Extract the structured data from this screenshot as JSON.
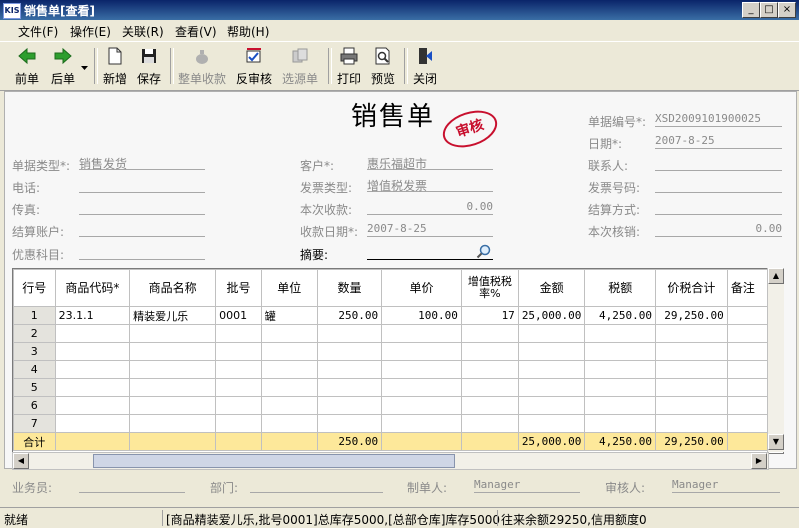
{
  "window": {
    "title": "销售单[查看]",
    "app_icon": "KIS",
    "minimize": "_",
    "restore": "□",
    "close": "×"
  },
  "menu": [
    "文件(F)",
    "操作(E)",
    "关联(R)",
    "查看(V)",
    "帮助(H)"
  ],
  "toolbar": {
    "prev": "前单",
    "next": "后单",
    "new": "新增",
    "save": "保存",
    "collect": "整单收款",
    "unapprove": "反审核",
    "select_source": "选源单",
    "print": "打印",
    "preview": "预览",
    "close": "关闭"
  },
  "icons": {
    "prev": "arrow-left-icon",
    "next": "arrow-right-icon",
    "new": "new-doc-icon",
    "save": "floppy-icon",
    "collect": "money-bag-icon",
    "unapprove": "unapprove-icon",
    "select_source": "select-source-icon",
    "print": "printer-icon",
    "preview": "preview-icon",
    "close": "exit-icon",
    "summary_lookup": "magnifier-icon"
  },
  "colors": {
    "title_bar": "#0a246a",
    "stamp": "#c8102e",
    "total_row": "#fde89a",
    "label_gray": "#8a8a8a"
  },
  "header": {
    "title": "销售单",
    "stamp": "审核",
    "doc_no_label": "单据编号*:",
    "doc_no": "XSD2009101900025",
    "date_label": "日期*:",
    "date": "2007-8-25",
    "doc_type_label": "单据类型*:",
    "doc_type": "销售发货",
    "customer_label": "客户*:",
    "customer": "惠乐福超市",
    "contact_label": "联系人:",
    "contact": "",
    "phone_label": "电话:",
    "phone": "",
    "invoice_type_label": "发票类型:",
    "invoice_type": "增值税发票",
    "invoice_no_label": "发票号码:",
    "invoice_no": "",
    "fax_label": "传真:",
    "fax": "",
    "this_receipt_label": "本次收款:",
    "this_receipt": "0.00",
    "settle_method_label": "结算方式:",
    "settle_method": "",
    "settle_account_label": "结算账户:",
    "settle_account": "",
    "receipt_date_label": "收款日期*:",
    "receipt_date": "2007-8-25",
    "this_writeoff_label": "本次核销:",
    "this_writeoff": "0.00",
    "discount_subject_label": "优惠科目:",
    "discount_subject": "",
    "summary_label": "摘要:",
    "summary": ""
  },
  "grid": {
    "columns": [
      "行号",
      "商品代码*",
      "商品名称",
      "批号",
      "单位",
      "数量",
      "单价",
      "增值税税率%",
      "金额",
      "税额",
      "价税合计",
      "备注"
    ],
    "rows": [
      {
        "no": "1",
        "code": "23.1.1",
        "name": "精装爱儿乐",
        "batch": "0001",
        "unit": "罐",
        "qty": "250.00",
        "price": "100.00",
        "rate": "17",
        "amount": "25,000.00",
        "tax": "4,250.00",
        "total": "29,250.00",
        "note": ""
      },
      {
        "no": "2",
        "code": "",
        "name": "",
        "batch": "",
        "unit": "",
        "qty": "",
        "price": "",
        "rate": "",
        "amount": "",
        "tax": "",
        "total": "",
        "note": ""
      },
      {
        "no": "3",
        "code": "",
        "name": "",
        "batch": "",
        "unit": "",
        "qty": "",
        "price": "",
        "rate": "",
        "amount": "",
        "tax": "",
        "total": "",
        "note": ""
      },
      {
        "no": "4",
        "code": "",
        "name": "",
        "batch": "",
        "unit": "",
        "qty": "",
        "price": "",
        "rate": "",
        "amount": "",
        "tax": "",
        "total": "",
        "note": ""
      },
      {
        "no": "5",
        "code": "",
        "name": "",
        "batch": "",
        "unit": "",
        "qty": "",
        "price": "",
        "rate": "",
        "amount": "",
        "tax": "",
        "total": "",
        "note": ""
      },
      {
        "no": "6",
        "code": "",
        "name": "",
        "batch": "",
        "unit": "",
        "qty": "",
        "price": "",
        "rate": "",
        "amount": "",
        "tax": "",
        "total": "",
        "note": ""
      },
      {
        "no": "7",
        "code": "",
        "name": "",
        "batch": "",
        "unit": "",
        "qty": "",
        "price": "",
        "rate": "",
        "amount": "",
        "tax": "",
        "total": "",
        "note": ""
      }
    ],
    "total": {
      "label": "合计",
      "qty": "250.00",
      "amount": "25,000.00",
      "tax": "4,250.00",
      "total": "29,250.00"
    }
  },
  "footer": {
    "salesperson_label": "业务员:",
    "salesperson": "",
    "department_label": "部门:",
    "department": "",
    "maker_label": "制单人:",
    "maker": "Manager",
    "approver_label": "审核人:",
    "approver": "Manager"
  },
  "status": {
    "ready": "就绪",
    "stock": "[商品精装爱儿乐,批号0001]总库存5000,[总部仓库]库存5000",
    "credit": "往来余额29250,信用额度0"
  }
}
